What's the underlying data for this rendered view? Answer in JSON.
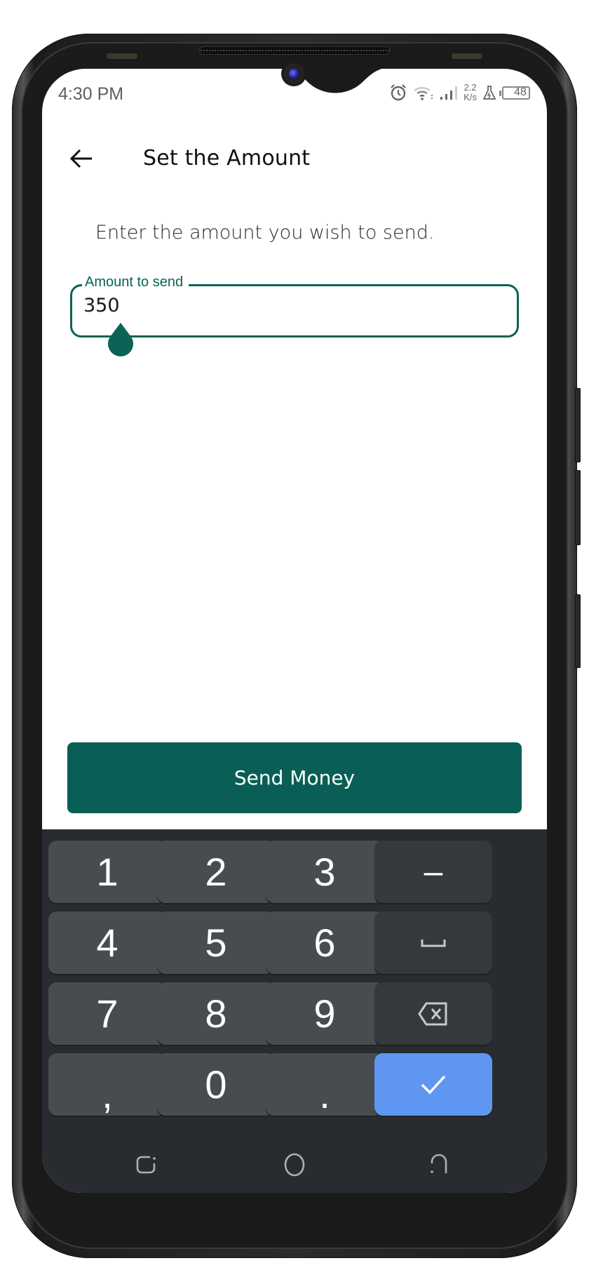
{
  "status_bar": {
    "time": "4:30 PM",
    "net_speed_value": "2.2",
    "net_speed_unit": "K/s",
    "battery_level": "48",
    "icons": [
      "alarm-icon",
      "wifi-icon",
      "signal-icon",
      "flask-icon",
      "battery-icon"
    ]
  },
  "app_bar": {
    "title": "Set the Amount",
    "back_icon": "arrow-left-icon"
  },
  "main": {
    "instruction": "Enter the amount you wish to send.",
    "amount_field": {
      "label": "Amount to send",
      "value": "350"
    },
    "send_button_label": "Send Money"
  },
  "keyboard": {
    "keys": [
      {
        "label": "1",
        "type": "digit"
      },
      {
        "label": "2",
        "type": "digit"
      },
      {
        "label": "3",
        "type": "digit"
      },
      {
        "label": "–",
        "type": "fn"
      },
      {
        "label": "4",
        "type": "digit"
      },
      {
        "label": "5",
        "type": "digit"
      },
      {
        "label": "6",
        "type": "digit"
      },
      {
        "label": "space",
        "type": "fn-icon",
        "icon": "space-icon"
      },
      {
        "label": "7",
        "type": "digit"
      },
      {
        "label": "8",
        "type": "digit"
      },
      {
        "label": "9",
        "type": "digit"
      },
      {
        "label": "backspace",
        "type": "fn-icon",
        "icon": "backspace-icon"
      },
      {
        "label": ",",
        "type": "digit"
      },
      {
        "label": "0",
        "type": "digit"
      },
      {
        "label": ".",
        "type": "digit"
      },
      {
        "label": "done",
        "type": "enter",
        "icon": "check-icon"
      }
    ],
    "colors": {
      "key": "#484c50",
      "fn_key": "#35393d",
      "enter_key": "#5f96f2",
      "background": "#282c30"
    }
  },
  "nav_bar": {
    "buttons": [
      "recents-icon",
      "home-icon",
      "back-icon"
    ]
  },
  "colors": {
    "accent": "#0b6355",
    "button": "#095f55"
  }
}
